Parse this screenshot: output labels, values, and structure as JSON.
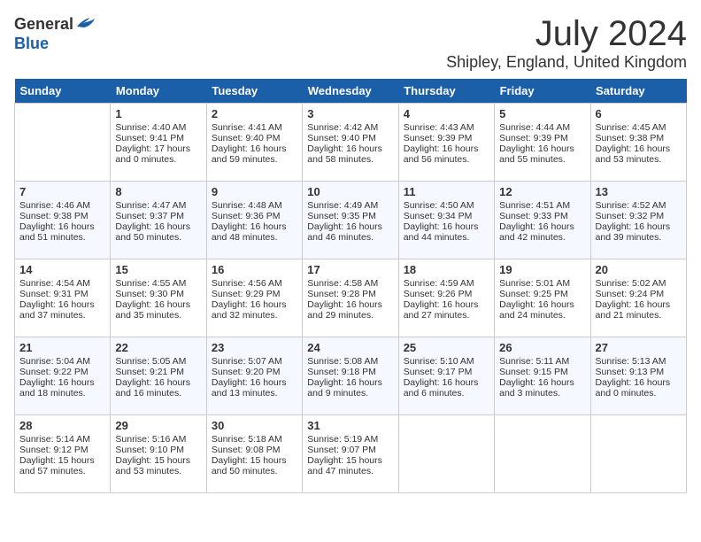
{
  "header": {
    "logo_general": "General",
    "logo_blue": "Blue",
    "month_year": "July 2024",
    "location": "Shipley, England, United Kingdom"
  },
  "days_of_week": [
    "Sunday",
    "Monday",
    "Tuesday",
    "Wednesday",
    "Thursday",
    "Friday",
    "Saturday"
  ],
  "weeks": [
    [
      {
        "day": "",
        "sunrise": "",
        "sunset": "",
        "daylight": ""
      },
      {
        "day": "1",
        "sunrise": "Sunrise: 4:40 AM",
        "sunset": "Sunset: 9:41 PM",
        "daylight": "Daylight: 17 hours and 0 minutes."
      },
      {
        "day": "2",
        "sunrise": "Sunrise: 4:41 AM",
        "sunset": "Sunset: 9:40 PM",
        "daylight": "Daylight: 16 hours and 59 minutes."
      },
      {
        "day": "3",
        "sunrise": "Sunrise: 4:42 AM",
        "sunset": "Sunset: 9:40 PM",
        "daylight": "Daylight: 16 hours and 58 minutes."
      },
      {
        "day": "4",
        "sunrise": "Sunrise: 4:43 AM",
        "sunset": "Sunset: 9:39 PM",
        "daylight": "Daylight: 16 hours and 56 minutes."
      },
      {
        "day": "5",
        "sunrise": "Sunrise: 4:44 AM",
        "sunset": "Sunset: 9:39 PM",
        "daylight": "Daylight: 16 hours and 55 minutes."
      },
      {
        "day": "6",
        "sunrise": "Sunrise: 4:45 AM",
        "sunset": "Sunset: 9:38 PM",
        "daylight": "Daylight: 16 hours and 53 minutes."
      }
    ],
    [
      {
        "day": "7",
        "sunrise": "Sunrise: 4:46 AM",
        "sunset": "Sunset: 9:38 PM",
        "daylight": "Daylight: 16 hours and 51 minutes."
      },
      {
        "day": "8",
        "sunrise": "Sunrise: 4:47 AM",
        "sunset": "Sunset: 9:37 PM",
        "daylight": "Daylight: 16 hours and 50 minutes."
      },
      {
        "day": "9",
        "sunrise": "Sunrise: 4:48 AM",
        "sunset": "Sunset: 9:36 PM",
        "daylight": "Daylight: 16 hours and 48 minutes."
      },
      {
        "day": "10",
        "sunrise": "Sunrise: 4:49 AM",
        "sunset": "Sunset: 9:35 PM",
        "daylight": "Daylight: 16 hours and 46 minutes."
      },
      {
        "day": "11",
        "sunrise": "Sunrise: 4:50 AM",
        "sunset": "Sunset: 9:34 PM",
        "daylight": "Daylight: 16 hours and 44 minutes."
      },
      {
        "day": "12",
        "sunrise": "Sunrise: 4:51 AM",
        "sunset": "Sunset: 9:33 PM",
        "daylight": "Daylight: 16 hours and 42 minutes."
      },
      {
        "day": "13",
        "sunrise": "Sunrise: 4:52 AM",
        "sunset": "Sunset: 9:32 PM",
        "daylight": "Daylight: 16 hours and 39 minutes."
      }
    ],
    [
      {
        "day": "14",
        "sunrise": "Sunrise: 4:54 AM",
        "sunset": "Sunset: 9:31 PM",
        "daylight": "Daylight: 16 hours and 37 minutes."
      },
      {
        "day": "15",
        "sunrise": "Sunrise: 4:55 AM",
        "sunset": "Sunset: 9:30 PM",
        "daylight": "Daylight: 16 hours and 35 minutes."
      },
      {
        "day": "16",
        "sunrise": "Sunrise: 4:56 AM",
        "sunset": "Sunset: 9:29 PM",
        "daylight": "Daylight: 16 hours and 32 minutes."
      },
      {
        "day": "17",
        "sunrise": "Sunrise: 4:58 AM",
        "sunset": "Sunset: 9:28 PM",
        "daylight": "Daylight: 16 hours and 29 minutes."
      },
      {
        "day": "18",
        "sunrise": "Sunrise: 4:59 AM",
        "sunset": "Sunset: 9:26 PM",
        "daylight": "Daylight: 16 hours and 27 minutes."
      },
      {
        "day": "19",
        "sunrise": "Sunrise: 5:01 AM",
        "sunset": "Sunset: 9:25 PM",
        "daylight": "Daylight: 16 hours and 24 minutes."
      },
      {
        "day": "20",
        "sunrise": "Sunrise: 5:02 AM",
        "sunset": "Sunset: 9:24 PM",
        "daylight": "Daylight: 16 hours and 21 minutes."
      }
    ],
    [
      {
        "day": "21",
        "sunrise": "Sunrise: 5:04 AM",
        "sunset": "Sunset: 9:22 PM",
        "daylight": "Daylight: 16 hours and 18 minutes."
      },
      {
        "day": "22",
        "sunrise": "Sunrise: 5:05 AM",
        "sunset": "Sunset: 9:21 PM",
        "daylight": "Daylight: 16 hours and 16 minutes."
      },
      {
        "day": "23",
        "sunrise": "Sunrise: 5:07 AM",
        "sunset": "Sunset: 9:20 PM",
        "daylight": "Daylight: 16 hours and 13 minutes."
      },
      {
        "day": "24",
        "sunrise": "Sunrise: 5:08 AM",
        "sunset": "Sunset: 9:18 PM",
        "daylight": "Daylight: 16 hours and 9 minutes."
      },
      {
        "day": "25",
        "sunrise": "Sunrise: 5:10 AM",
        "sunset": "Sunset: 9:17 PM",
        "daylight": "Daylight: 16 hours and 6 minutes."
      },
      {
        "day": "26",
        "sunrise": "Sunrise: 5:11 AM",
        "sunset": "Sunset: 9:15 PM",
        "daylight": "Daylight: 16 hours and 3 minutes."
      },
      {
        "day": "27",
        "sunrise": "Sunrise: 5:13 AM",
        "sunset": "Sunset: 9:13 PM",
        "daylight": "Daylight: 16 hours and 0 minutes."
      }
    ],
    [
      {
        "day": "28",
        "sunrise": "Sunrise: 5:14 AM",
        "sunset": "Sunset: 9:12 PM",
        "daylight": "Daylight: 15 hours and 57 minutes."
      },
      {
        "day": "29",
        "sunrise": "Sunrise: 5:16 AM",
        "sunset": "Sunset: 9:10 PM",
        "daylight": "Daylight: 15 hours and 53 minutes."
      },
      {
        "day": "30",
        "sunrise": "Sunrise: 5:18 AM",
        "sunset": "Sunset: 9:08 PM",
        "daylight": "Daylight: 15 hours and 50 minutes."
      },
      {
        "day": "31",
        "sunrise": "Sunrise: 5:19 AM",
        "sunset": "Sunset: 9:07 PM",
        "daylight": "Daylight: 15 hours and 47 minutes."
      },
      {
        "day": "",
        "sunrise": "",
        "sunset": "",
        "daylight": ""
      },
      {
        "day": "",
        "sunrise": "",
        "sunset": "",
        "daylight": ""
      },
      {
        "day": "",
        "sunrise": "",
        "sunset": "",
        "daylight": ""
      }
    ]
  ]
}
